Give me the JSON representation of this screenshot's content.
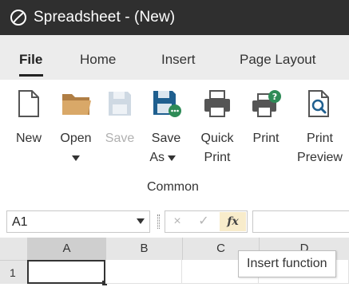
{
  "window": {
    "title": "Spreadsheet - (New)"
  },
  "tabs": [
    {
      "label": "File",
      "active": true
    },
    {
      "label": "Home",
      "active": false
    },
    {
      "label": "Insert",
      "active": false
    },
    {
      "label": "Page Layout",
      "active": false
    }
  ],
  "ribbon": {
    "buttons": [
      {
        "id": "new",
        "label": "New",
        "icon": "new-document-icon",
        "enabled": true
      },
      {
        "id": "open",
        "label": "Open",
        "icon": "folder-icon",
        "enabled": true,
        "has_dropdown": true
      },
      {
        "id": "save",
        "label": "Save",
        "icon": "save-icon",
        "enabled": false
      },
      {
        "id": "save-as",
        "label_line1": "Save",
        "label_line2": "As",
        "icon": "save-as-icon",
        "enabled": true,
        "has_dropdown": true
      },
      {
        "id": "quick-print",
        "label_line1": "Quick",
        "label_line2": "Print",
        "icon": "printer-icon",
        "enabled": true
      },
      {
        "id": "print",
        "label": "Print",
        "icon": "print-dialog-icon",
        "enabled": true
      },
      {
        "id": "print-preview",
        "label_line1": "Print",
        "label_line2": "Preview",
        "icon": "print-preview-icon",
        "enabled": true
      }
    ],
    "group_label": "Common"
  },
  "formula_bar": {
    "name_box": "A1",
    "cancel_icon": "×",
    "accept_icon": "✓",
    "insert_function_label": "fx",
    "formula_value": ""
  },
  "grid": {
    "columns": [
      "A",
      "B",
      "C",
      "D"
    ],
    "rows": [
      "1"
    ],
    "selected_cell": "A1"
  },
  "tooltip": {
    "text": "Insert function"
  },
  "colors": {
    "titlebar": "#2f2f2f",
    "tabbar": "#ececec",
    "save_as_blue": "#1f5f8f",
    "folder": "#c89a5e",
    "print_badge": "#2e8b57",
    "fx_highlight": "#f8eccb"
  }
}
